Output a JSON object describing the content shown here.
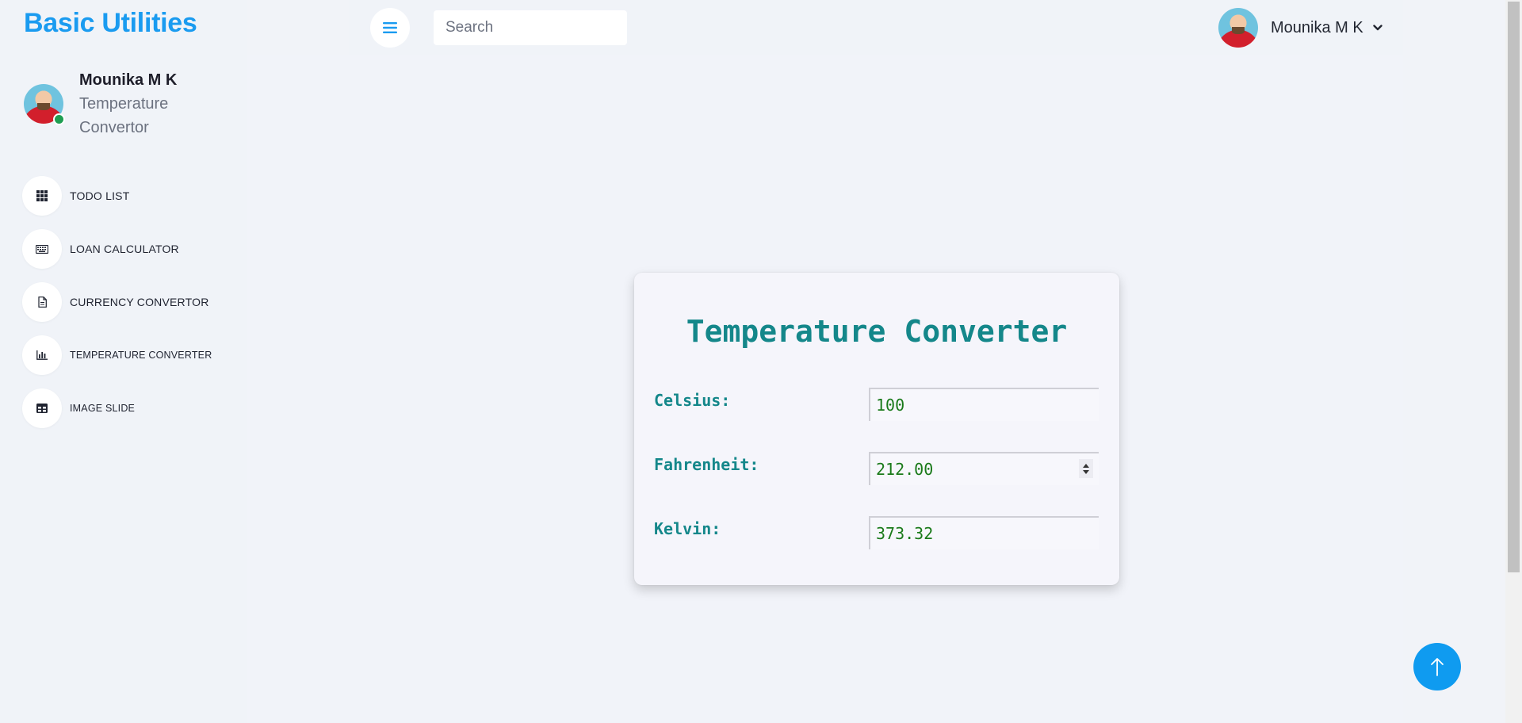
{
  "brand": {
    "title": "Basic Utilities"
  },
  "profile": {
    "name": "Mounika M K",
    "role": "Temperature Convertor"
  },
  "nav": {
    "items": [
      {
        "label": "TODO LIST",
        "icon": "grid-icon"
      },
      {
        "label": "LOAN CALCULATOR",
        "icon": "keyboard-icon"
      },
      {
        "label": "CURRENCY CONVERTOR",
        "icon": "document-icon"
      },
      {
        "label": "TEMPERATURE CONVERTER",
        "icon": "bar-chart-icon"
      },
      {
        "label": "IMAGE SLIDE",
        "icon": "table-icon"
      }
    ]
  },
  "topbar": {
    "search_placeholder": "Search",
    "user_name": "Mounika M K"
  },
  "converter": {
    "title": "Temperature Converter",
    "celsius_label": "Celsius:",
    "celsius_value": "100",
    "fahrenheit_label": "Fahrenheit:",
    "fahrenheit_value": "212.00",
    "kelvin_label": "Kelvin:",
    "kelvin_value": "373.32"
  },
  "colors": {
    "brand": "#1a9bf0",
    "accent_teal": "#14878a",
    "value_green": "#1a7a1a",
    "scrolltop_button": "#0f9bf0",
    "online_status": "#1e9e52"
  }
}
